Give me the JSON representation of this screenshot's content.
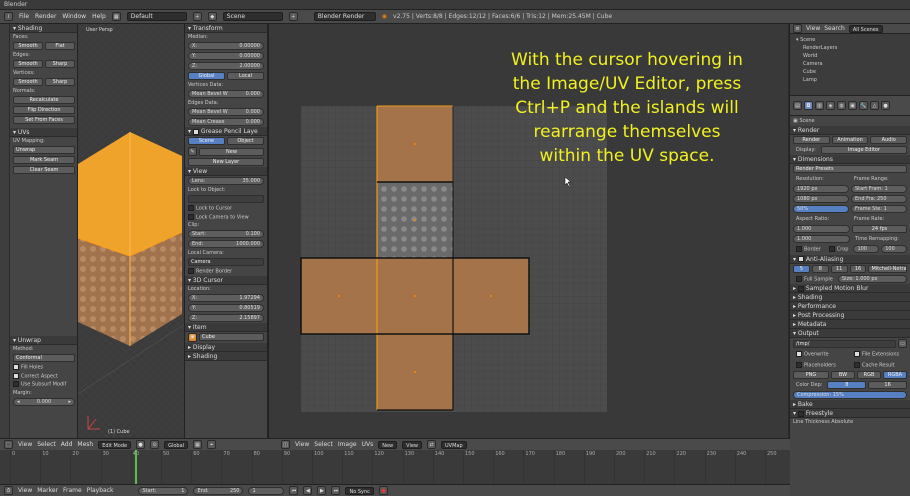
{
  "window": {
    "title": "Blender"
  },
  "topbar": {
    "menus": [
      "File",
      "Render",
      "Window",
      "Help"
    ],
    "layout": "Default",
    "scene": "Scene",
    "engine": "Blender Render",
    "stats": "v2.75 | Verts:8/8 | Edges:12/12 | Faces:6/6 | Tris:12 | Mem:25.45M | Cube"
  },
  "tools_panel": {
    "shading_title": "Shading",
    "faces_label": "Faces:",
    "edges_label": "Edges:",
    "vertices_label": "Vertices:",
    "smooth": "Smooth",
    "flat": "Flat",
    "sharp": "Sharp",
    "normals_label": "Normals:",
    "recalculate": "Recalculate",
    "flip_direction": "Flip Direction",
    "set_from_faces": "Set From Faces",
    "uvs_title": "UVs",
    "uv_mapping_label": "UV Mapping:",
    "unwrap": "Unwrap",
    "mark_seam": "Mark Seam",
    "clear_seam": "Clear Seam",
    "unwrap_op_title": "Unwrap",
    "method_label": "Method:",
    "method_value": "Conformal",
    "fill_holes": "Fill Holes",
    "correct_aspect": "Correct Aspect",
    "use_subsurf": "Use Subsurf Modif",
    "margin_label": "Margin:",
    "margin_value": "0.000"
  },
  "viewport": {
    "label": "User Persp",
    "object_label": "(1) Cube"
  },
  "n_panel": {
    "transform_title": "Transform",
    "median_label": "Median:",
    "x": "X:",
    "y": "Y:",
    "z": "Z:",
    "median_x": "0.00000",
    "median_y": "0.00000",
    "median_z": "2.00000",
    "global": "Global",
    "local": "Local",
    "vertices_data": "Vertices Data:",
    "mean_bevel_weight": "Mean Bevel W",
    "mean_bevel_value": "0.000",
    "edges_data": "Edges Data:",
    "mean_bevel_edge": "Mean Bevel W",
    "mean_crease": "Mean Crease",
    "grease_pencil_title": "Grease Pencil Laye",
    "scene_btn": "Scene",
    "object_btn": "Object",
    "new_btn": "New",
    "new_layer_btn": "New Layer",
    "view_title": "View",
    "lens_label": "Lens:",
    "lens_value": "35.000",
    "lock_to_object": "Lock to Object:",
    "lock_to_cursor": "Lock to Cursor",
    "lock_camera": "Lock Camera to View",
    "clip_label": "Clip:",
    "clip_start_label": "Start:",
    "clip_start_value": "0.100",
    "clip_end_label": "End:",
    "clip_end_value": "1000.000",
    "local_camera": "Local Camera:",
    "camera_field": "Camera",
    "render_border": "Render Border",
    "cursor_title": "3D Cursor",
    "location_label": "Location:",
    "cursor_x": "1.97294",
    "cursor_y": "0.80519",
    "cursor_z": "2.15897",
    "item_title": "Item",
    "item_name": "Cube",
    "display_title": "Display",
    "shading_title": "Shading"
  },
  "caption": {
    "line1": "With the cursor hovering in",
    "line2": "the Image/UV Editor, press",
    "line3": "Ctrl+P and the islands will",
    "line4": "rearrange themselves",
    "line5": "within the UV space."
  },
  "outliner": {
    "view": "View",
    "search": "Search",
    "scenes": "All Scenes",
    "items": [
      "Scene",
      "RenderLayers",
      "World",
      "Camera",
      "Cube",
      "Lamp"
    ]
  },
  "properties": {
    "object_name": "Scene",
    "render_title": "Render",
    "render_btn": "Render",
    "animation_btn": "Animation",
    "audio_btn": "Audio",
    "display_label": "Display:",
    "display_value": "Image Editor",
    "dimensions_title": "Dimensions",
    "presets": "Render Presets",
    "resolution_label": "Resolution:",
    "res_x": "1920 px",
    "res_y": "1080 px",
    "res_pct": "50%",
    "frame_range_label": "Frame Range:",
    "start_frame": "Start Fram: 1",
    "end_frame": "End Fra: 250",
    "frame_step": "Frame Ste: 1",
    "aspect_label": "Aspect Ratio:",
    "aspect_x": "1.000",
    "aspect_y": "1.000",
    "frame_rate_label": "Frame Rate:",
    "fps": "24 fps",
    "time_remap": "Time Remapping:",
    "remap_old": "100",
    "remap_new": "100",
    "border": "Border",
    "crop": "Crop",
    "antialiasing_title": "Anti-Aliasing",
    "aa_values": [
      "5",
      "8",
      "11",
      "16"
    ],
    "filter": "Mitchell-Netrav",
    "full_sample": "Full Sample",
    "filter_size": "Size: 1.000 px",
    "sampled_motion_blur": "Sampled Motion Blur",
    "shading": "Shading",
    "performance": "Performance",
    "post_processing": "Post Processing",
    "metadata": "Metadata",
    "output_title": "Output",
    "output_path": "/tmp/",
    "overwrite": "Overwrite",
    "file_extensions": "File Extensions",
    "placeholders": "Placeholders",
    "cache_result": "Cache Result",
    "format": "PNG",
    "bw": "BW",
    "rgb": "RGB",
    "rgba": "RGBA",
    "color_depth_label": "Color Dep:",
    "depth_8": "8",
    "depth_16": "16",
    "compression": "Compression: 15%",
    "bake": "Bake",
    "freestyle": "Freestyle",
    "line_thickness": "Line Thickness Absolute"
  },
  "uv_header": {
    "menus": [
      "View",
      "Select",
      "Image",
      "UVs"
    ],
    "image_name": "New",
    "view_label": "View",
    "sync": "UVMap"
  },
  "view3d_header": {
    "menus": [
      "View",
      "Select",
      "Add",
      "Mesh"
    ],
    "mode": "Edit Mode",
    "pivot": "Global"
  },
  "timeline": {
    "ticks": [
      "0",
      "10",
      "20",
      "30",
      "40",
      "50",
      "60",
      "70",
      "80",
      "90",
      "100",
      "110",
      "120",
      "130",
      "140",
      "150",
      "160",
      "170",
      "180",
      "190",
      "200",
      "210",
      "220",
      "230",
      "240",
      "250"
    ]
  },
  "footer": {
    "menus": [
      "View",
      "Marker",
      "Frame",
      "Playback"
    ],
    "start_label": "Start:",
    "start_value": "1",
    "end_label": "End:",
    "end_value": "250",
    "current_frame": "1",
    "sync_mode": "No Sync"
  },
  "colors": {
    "caption": "#f1f21f",
    "uv_fill": "#a5734a",
    "selection": "#f09a1b",
    "panel_bg": "#454545"
  }
}
